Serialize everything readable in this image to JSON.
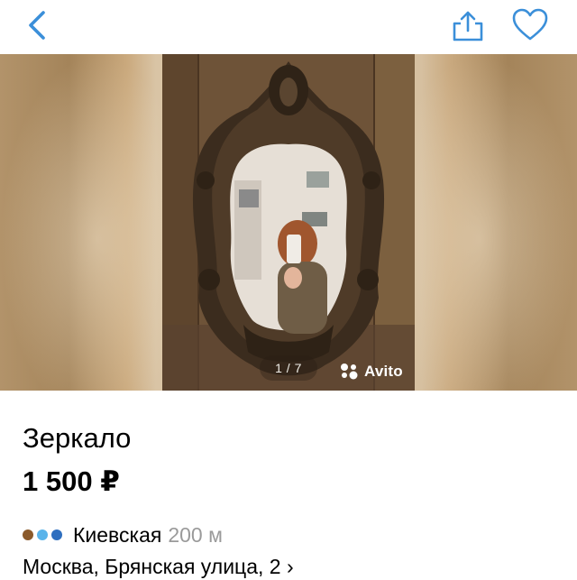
{
  "nav": {
    "back_icon": "chevron-left-icon",
    "share_icon": "share-icon",
    "favorite_icon": "heart-icon",
    "accent": "#3b8fd9"
  },
  "gallery": {
    "counter": "1 / 7",
    "watermark": "Avito",
    "current_index": 1,
    "total": 7
  },
  "listing": {
    "title": "Зеркало",
    "price": "1 500 ₽",
    "metro": {
      "station": "Киевская",
      "distance": "200 м",
      "line_colors": [
        "#8b5a2b",
        "#5ab4ea",
        "#2f6fbf"
      ]
    },
    "address": "Москва, Брянская улица, 2 ›"
  }
}
